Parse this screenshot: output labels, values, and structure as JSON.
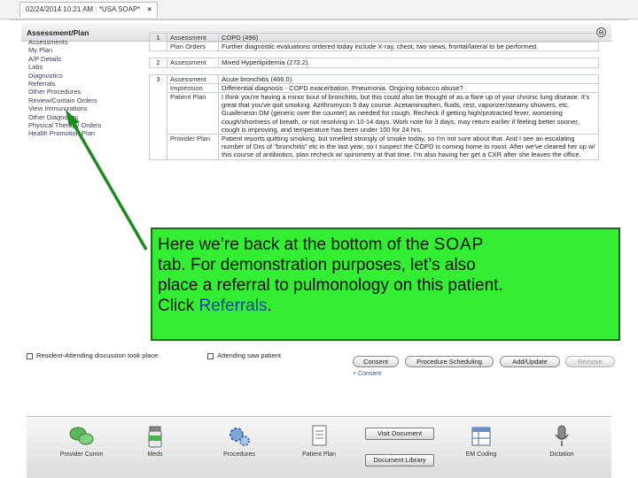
{
  "tab": {
    "title": "02/24/2014 10:21 AM : *USA SOAP*",
    "close": "×"
  },
  "panel": {
    "title": "Assessment/Plan",
    "collapse": "⊖"
  },
  "nav": {
    "items": [
      "Assessments",
      "My Plan",
      "A/P Details",
      "Labs",
      "Diagnostics",
      "Referrals",
      "Other Procedures",
      "Review/Contain Orders",
      "View Immunizations",
      "Other Diagnoses",
      "Physical Therapy Orders",
      "Health Promotion Plan"
    ]
  },
  "problems": [
    {
      "num": "1",
      "rows": [
        {
          "label": "Assessment",
          "text": "COPD (496)"
        },
        {
          "label": "Plan Orders",
          "text": "Further diagnostic evaluations ordered today include X-ray, chest, two views, frontal/lateral to be performed."
        }
      ]
    },
    {
      "num": "2",
      "rows": [
        {
          "label": "Assessment",
          "text": "Mixed Hyperlipidemia (272.2)."
        }
      ]
    },
    {
      "num": "3",
      "rows": [
        {
          "label": "Assessment",
          "text": "Acute bronchitis (466.0)."
        },
        {
          "label": "Impression",
          "text": "Differential diagnosis - COPD exacerbation, Pneumonia. Ongoing tobacco abuse?"
        },
        {
          "label": "Patient Plan",
          "text": "I think you're having a minor bout of bronchitis, but this could also be thought of as a flare up of your chronic lung disease. It's great that you've quit smoking. Azithromycin 5 day course. Acetaminophen, fluids, rest, vaporizer/steamy showers, etc. Guaifenesin DM (generic over the counter) as needed for cough. Recheck if getting high/protracted fever, worsening cough/shortness of breath, or not resolving in 10-14 days. Work note for 3 days, may return earlier if feeling better sooner, cough is improving, and temperature has been under 100 for 24 hrs."
        },
        {
          "label": "Provider Plan",
          "text": "Patient reports quitting smoking, but smelled strongly of smoke today, so I'm not sure about that. And I see an escalating number of Dxs of \"bronchitis\" etc in the last year, so I suspect the COPD is coming home to roost. After we've cleared her up w/ this course of antibiotics, plan recheck w/ spirometry at that time. I'm also having her get a CXR after she leaves the office."
        }
      ]
    }
  ],
  "callout": {
    "line1_pre": "Here we’re back at the bottom of the ",
    "line1_brand": "SOAP",
    "line2": "tab.  For demonstration purposes, let’s also",
    "line3": "place a referral to pulmonology on this patient.",
    "line4_pre": "Click ",
    "line4_link": "Referrals",
    "line4_post": "."
  },
  "checkboxes": {
    "resident": "Resident-Attending discussion took place",
    "attending": "Attending saw patient"
  },
  "buttons": {
    "consent": "Consent",
    "procedure_scheduling": "Procedure Scheduling",
    "add_update": "Add/Update",
    "remove": "Remove"
  },
  "consent_link": "+ Consent",
  "dock": {
    "provider_comm": "Provider Comm",
    "meds": "Meds",
    "procedures": "Procedures",
    "patient_plan": "Patient Plan",
    "visit_document": "Visit Document",
    "document_library": "Document Library",
    "em_coding": "EM Coding",
    "dictation": "Dictation"
  },
  "colors": {
    "callout_bg": "#33ee33",
    "callout_border": "#1c6a1c",
    "arrow": "#1c8a1c",
    "link": "#1f3fa8"
  }
}
